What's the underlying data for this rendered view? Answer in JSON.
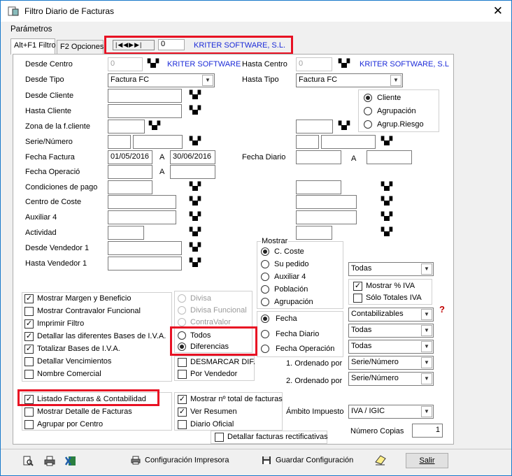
{
  "window": {
    "title": "Filtro Diario de Facturas",
    "close": "✕"
  },
  "menu": {
    "parametros": "Parámetros"
  },
  "tabs": [
    {
      "label": "Alt+F1 Filtro"
    },
    {
      "label": "F2 Opciones"
    }
  ],
  "record_nav": {
    "number": "0",
    "company": "KRITER SOFTWARE, S.L."
  },
  "labels": {
    "desde_centro": "Desde Centro",
    "hasta_centro": "Hasta Centro",
    "desde_tipo": "Desde Tipo",
    "hasta_tipo": "Hasta Tipo",
    "desde_cliente": "Desde Cliente",
    "hasta_cliente": "Hasta Cliente",
    "zona": "Zona de la f.cliente",
    "serie": "Serie/Número",
    "fecha_factura": "Fecha Factura",
    "a1": "A",
    "fecha_diario": "Fecha Diario",
    "a2": "A",
    "fecha_operacion": "Fecha Operació",
    "a3": "A",
    "condiciones": "Condiciones de pago",
    "centro_coste": "Centro de Coste",
    "auxiliar4": "Auxiliar 4",
    "actividad": "Actividad",
    "desde_vendedor": "Desde Vendedor 1",
    "hasta_vendedor": "Hasta Vendedor 1"
  },
  "values": {
    "desde_centro": "0",
    "desde_centro_name": "KRITER SOFTWARE",
    "hasta_centro": "0",
    "hasta_centro_name": "KRITER SOFTWARE, S.L",
    "desde_tipo": "Factura FC",
    "hasta_tipo": "Factura FC",
    "fecha_desde": "01/05/2016",
    "fecha_hasta": "30/06/2016"
  },
  "tipo_radio": [
    "Cliente",
    "Agrupación",
    "Agrup.Riesgo"
  ],
  "mostrar": {
    "title": "Mostrar",
    "options": [
      "C. Coste",
      "Su pedido",
      "Auxiliar 4",
      "Población",
      "Agrupación"
    ],
    "fechas": [
      "Fecha",
      "Fecha Diario",
      "Fecha Operación"
    ]
  },
  "right_selects": {
    "todas1": "Todas",
    "mostrar_iva": "Mostrar % IVA",
    "solo_totales": "Sólo Totales IVA",
    "contabilizables": "Contabilizables",
    "todas2": "Todas",
    "todas3": "Todas",
    "ordenado1_label": "1. Ordenado por",
    "ordenado1": "Serie/Número",
    "ordenado2_label": "2. Ordenado por",
    "ordenado2": "Serie/Número",
    "ambito_label": "Ámbito Impuesto",
    "ambito": "IVA / IGIC",
    "copias_label": "Número Copias",
    "copias": "1"
  },
  "left_checks": [
    {
      "label": "Mostrar Margen y Beneficio",
      "checked": true
    },
    {
      "label": "Mostrar Contravalor Funcional",
      "checked": false
    },
    {
      "label": "Imprimir Filtro",
      "checked": true
    },
    {
      "label": "Detallar las diferentes Bases de I.V.A.",
      "checked": true
    },
    {
      "label": "Totalizar Bases de I.V.A.",
      "checked": true
    },
    {
      "label": "Detallar Vencimientos",
      "checked": false
    },
    {
      "label": "Nombre Comercial",
      "checked": false
    }
  ],
  "divisa_radio": [
    "Divisa",
    "Divisa Funcional",
    "ContraValor",
    "Todos",
    "Diferencias"
  ],
  "mid_checks": {
    "desmarcar": "DESMARCAR DIF.",
    "por_vendedor": "Por Vendedor"
  },
  "bottom_checks": {
    "listado": "Listado Facturas & Contabilidad",
    "mostrar_detalle": "Mostrar Detalle de Facturas",
    "agrupar": "Agrupar por Centro",
    "mostrar_total": "Mostrar nº total de facturas",
    "ver_resumen": "Ver Resumen",
    "diario_oficial": "Diario Oficial",
    "detallar_rect": "Detallar facturas rectificativas"
  },
  "footer": {
    "config_impresora": "Configuración Impresora",
    "guardar": "Guardar Configuración",
    "salir": "Salir"
  },
  "colors": {
    "highlight": "#e81123",
    "link_blue": "#1c2bd8",
    "title_border": "#1979ca"
  }
}
